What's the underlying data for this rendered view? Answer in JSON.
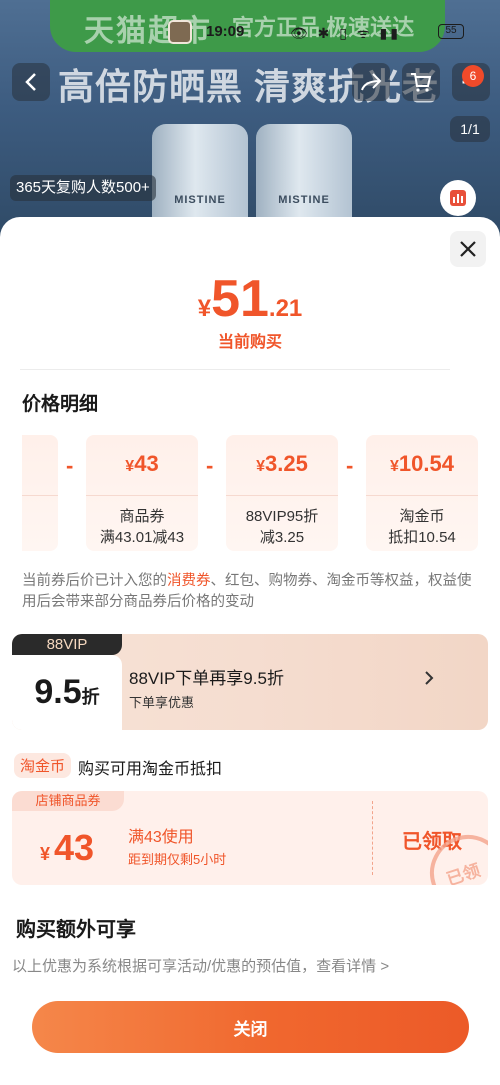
{
  "background": {
    "brand": "天猫超市",
    "brand_sub": "官方正品 极速送达",
    "headline": "高倍防晒黑 清爽抗光老",
    "bottle_label": "MISTINE",
    "bottle_label_2": "MISTINE",
    "repurchase": "365天复购人数500+",
    "pager": "1/1",
    "cart_badge": "6"
  },
  "status_bar": {
    "time": "19:09",
    "icons": "👁 ✱ ▯ ᯤ ▮▮",
    "battery": "55"
  },
  "price": {
    "currency": "¥",
    "integer": "51",
    "decimal": ".21",
    "label": "当前购买"
  },
  "breakdown": {
    "title": "价格明细",
    "cards": [
      {
        "currency": "¥",
        "amount": "43",
        "line1": "商品券",
        "line2": "满43.01减43"
      },
      {
        "currency": "¥",
        "amount": "3.25",
        "line1": "88VIP95折",
        "line2": "减3.25"
      },
      {
        "currency": "¥",
        "amount": "10.54",
        "line1": "淘金币",
        "line2": "抵扣10.54"
      }
    ],
    "minus": "-",
    "note_pre": "当前券后价已计入您的",
    "note_hl": "消费券",
    "note_post": "、红包、购物券、淘金币等权益，权益使用后会带来部分商品券后价格的变动"
  },
  "vip": {
    "tag": "88VIP",
    "value": "9.5",
    "unit": "折",
    "title": "88VIP下单再享9.5折",
    "subtitle": "下单享优惠"
  },
  "coin": {
    "tag": "淘金币",
    "text": "购买可用淘金币抵扣"
  },
  "coupon": {
    "tag": "店铺商品券",
    "currency": "¥",
    "amount": "43",
    "condition": "满43使用",
    "expiry": "距到期仅剩5小时",
    "status": "已领取",
    "stamp": "已领"
  },
  "extra": {
    "title": "购买额外可享",
    "note": "以上优惠为系统根据可享活动/优惠的预估值，查看详情 >"
  },
  "close_button": "关闭",
  "colors": {
    "accent": "#f0552a",
    "vip_dark": "#2a2a2a",
    "banner": "#3e9a49"
  }
}
